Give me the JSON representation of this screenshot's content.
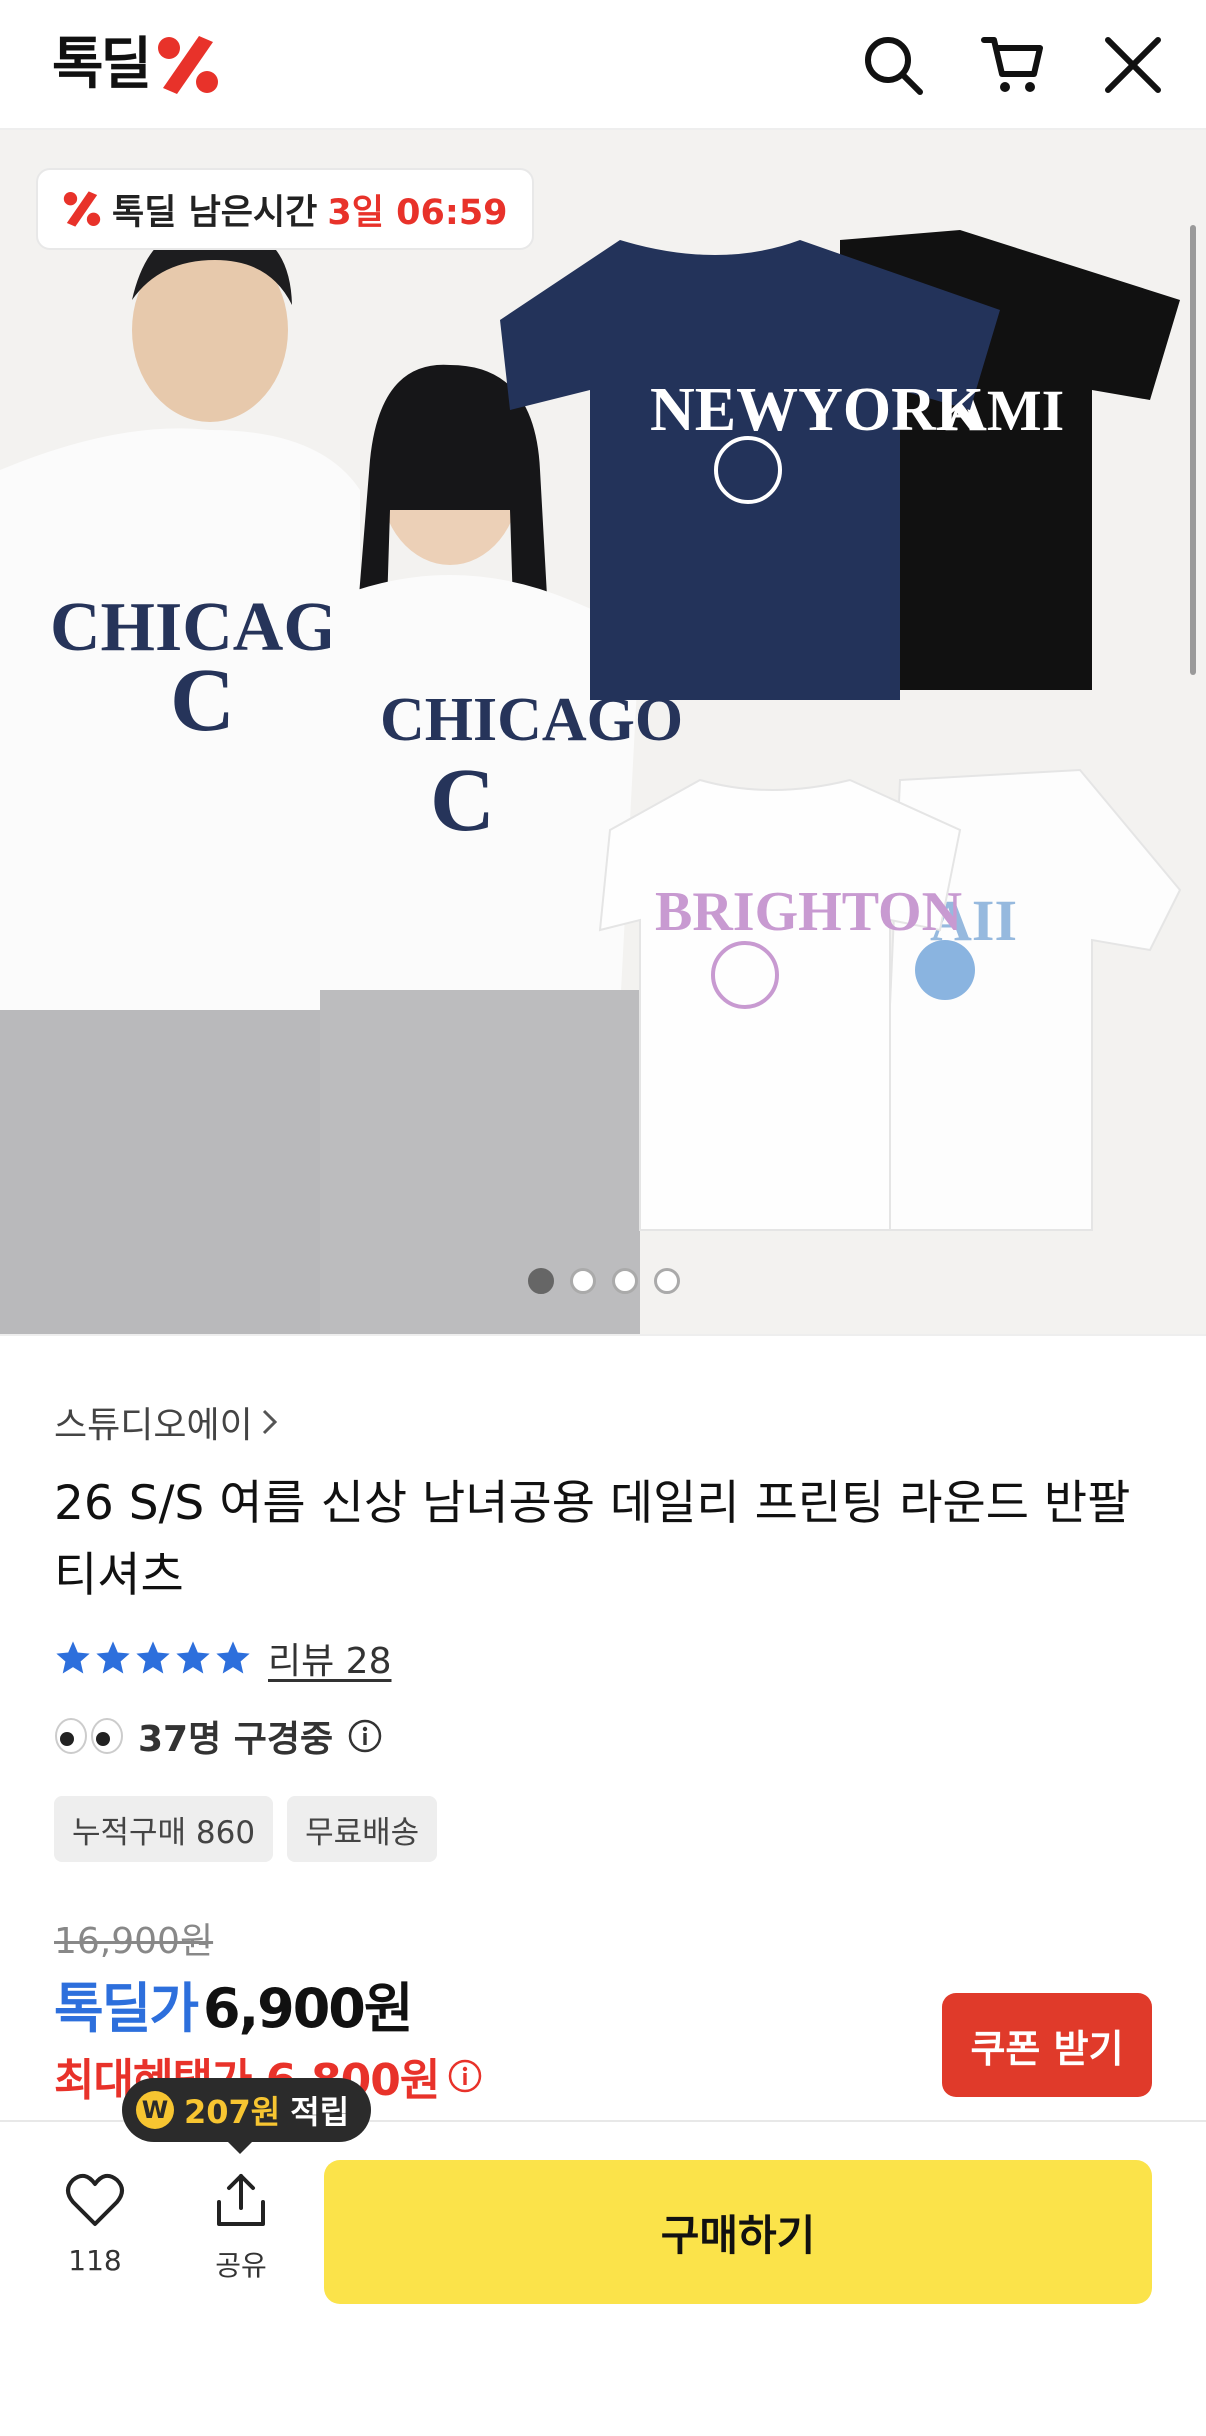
{
  "header": {
    "logo_text": "톡딜",
    "icons": [
      "search-icon",
      "cart-icon",
      "close-icon"
    ]
  },
  "hero": {
    "timer_label": "톡딜 남은시간",
    "timer_value": "3일 06:59",
    "slide_count": 4,
    "active_slide": 1
  },
  "product": {
    "brand": "스튜디오에이",
    "title": "26 S/S 여름 신상 남녀공용 데일리 프린팅 라운드 반팔 티셔츠",
    "rating_stars": 5,
    "review_label": "리뷰 28",
    "viewers": "37명 구경중",
    "tags": [
      "누적구매 860",
      "무료배송"
    ],
    "original_price": "16,900원",
    "deal_label": "톡딜가",
    "deal_price": "6,900원",
    "max_benefit": "최대혜택가 6,800원",
    "coupon_button": "쿠폰 받기"
  },
  "bottom_bar": {
    "points_amount": "207원",
    "points_suffix": "적립",
    "like_count": "118",
    "share_label": "공유",
    "buy_button": "구매하기"
  },
  "colors": {
    "brand_red": "#e8322a",
    "deal_blue": "#2d6fdc",
    "buy_yellow": "#fbe34a",
    "coupon_red": "#e03a2a"
  }
}
